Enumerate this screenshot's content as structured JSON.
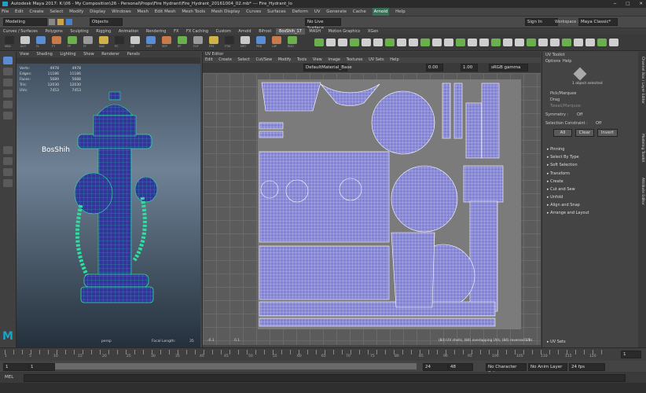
{
  "title_bar": {
    "text": "Autodesk Maya 2017: K:\\06 - My Composition\\26 - Personal\\Props\\Fire Hydrant\\Fire_Hydrant_20161004_02.mb* --- Fire_Hydrant_lo"
  },
  "menu": {
    "items": [
      "File",
      "Edit",
      "Create",
      "Select",
      "Modify",
      "Display",
      "Windows",
      "Mesh",
      "Edit Mesh",
      "Mesh Tools",
      "Mesh Display",
      "Curves",
      "Surfaces",
      "Deform",
      "UV",
      "Generate",
      "Cache",
      "Arnold",
      "Help"
    ],
    "highlight": "Arnold"
  },
  "status_line": {
    "mode": "Modeling",
    "objects_label": "Objects",
    "live_surface": "No Live Surface",
    "sign_in": "Sign In",
    "workspace_label": "Workspace :",
    "workspace_value": "Maya Classic*"
  },
  "shelf": {
    "tabs": [
      "Curves / Surfaces",
      "Polygons",
      "Sculpting",
      "Rigging",
      "Animation",
      "Rendering",
      "FX",
      "FX Caching",
      "Custom",
      "Arnold",
      "Bifrost",
      "BosShih_17",
      "MASH",
      "Motion Graphics",
      "XGen"
    ],
    "active": "BosShih_17",
    "icon_labels": [
      "MSA",
      "AUT",
      "FL",
      "FT",
      "FP",
      "FF",
      "NAV",
      "PC",
      "GE",
      "MRT",
      "SRP",
      "RP",
      "FGF",
      "FPX",
      "FTM",
      "MRT",
      "PRB",
      "LSP",
      "RDO"
    ]
  },
  "viewport": {
    "menu": [
      "View",
      "Shading",
      "Lighting",
      "Show",
      "Renderer",
      "Panels"
    ],
    "hud": [
      {
        "k": "Verts:",
        "a": "4978",
        "b": "4978"
      },
      {
        "k": "Edges:",
        "a": "11186",
        "b": "11186"
      },
      {
        "k": "Faces:",
        "a": "5689",
        "b": "5688"
      },
      {
        "k": "Tris:",
        "a": "12030",
        "b": "12030"
      },
      {
        "k": "UVs:",
        "a": "7453",
        "b": "7453"
      }
    ],
    "watermark": "BosShih",
    "camera": "persp",
    "focal_label": "Focal Length:",
    "focal": "35"
  },
  "uv_editor": {
    "title": "UV Editor",
    "menu": [
      "Edit",
      "Create",
      "Select",
      "Cut/Sew",
      "Modify",
      "Tools",
      "View",
      "Image",
      "Textures",
      "UV Sets",
      "Help"
    ],
    "material": "DefaultMaterial_Base",
    "val1": "0.00",
    "val2": "1.00",
    "colorspace": "sRGB gamma",
    "status": "(84) UV shells, (84) overlapping UVs, (84) reversed UVs",
    "axis": {
      "x0": "-0.1",
      "x1": "0.1",
      "x2": "1.1",
      "y": "1.1"
    }
  },
  "toolkit": {
    "title": "UV Toolkit",
    "menu": [
      "Options",
      "Help"
    ],
    "selected": "1 object selected",
    "pick": "Pick/Marquee",
    "drag": "Drag",
    "tweak": "Tweak/Marquee",
    "symmetry_label": "Symmetry :",
    "symmetry": "Off",
    "constraint_label": "Selection Constraint :",
    "constraint": "Off",
    "buttons": [
      "All",
      "Clear",
      "Invert"
    ],
    "sections": [
      "Pinning",
      "Select By Type",
      "Soft Selection",
      "Transform",
      "Create",
      "Cut and Sew",
      "Unfold",
      "Align and Snap",
      "Arrange and Layout"
    ],
    "footer": "UV Sets",
    "side_tabs": [
      "Channel Box / Layer Editor",
      "Modeling Toolkit",
      "Attribute Editor"
    ]
  },
  "time": {
    "ticks": [
      "1",
      "5",
      "10",
      "15",
      "20",
      "25",
      "30",
      "35",
      "40",
      "45",
      "50",
      "55",
      "60",
      "65",
      "70",
      "75",
      "80",
      "85",
      "90",
      "95",
      "100",
      "105",
      "110",
      "115",
      "120"
    ],
    "current": "1"
  },
  "range": {
    "start": "1",
    "start2": "1",
    "end": "24",
    "end2": "48",
    "char_set": "No Character Set",
    "anim_layer": "No Anim Layer",
    "fps": "24 fps"
  },
  "cmd": {
    "lang": "MEL"
  },
  "colors": {
    "accent": "#5a8dd6",
    "uv_shell": "#7b7dc8",
    "wire": "#2ee0a0",
    "mesh": "#3a3a9a"
  }
}
